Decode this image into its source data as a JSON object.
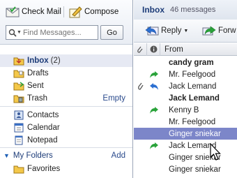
{
  "toolbar": {
    "check_mail": "Check Mail",
    "compose": "Compose",
    "search_placeholder": "Find Messages...",
    "go": "Go"
  },
  "folders": [
    {
      "label": "Inbox",
      "count": "(2)",
      "icon": "inbox-icon"
    },
    {
      "label": "Drafts",
      "icon": "drafts-folder-icon"
    },
    {
      "label": "Sent",
      "icon": "sent-folder-icon"
    },
    {
      "label": "Trash",
      "action": "Empty",
      "icon": "trash-icon"
    }
  ],
  "apps": [
    {
      "label": "Contacts",
      "icon": "contacts-icon"
    },
    {
      "label": "Calendar",
      "icon": "calendar-icon"
    },
    {
      "label": "Notepad",
      "icon": "notepad-icon"
    }
  ],
  "my_folders": {
    "label": "My Folders",
    "add": "Add",
    "items": [
      {
        "label": "Favorites",
        "icon": "folder-icon"
      }
    ]
  },
  "message_list": {
    "title": "Inbox",
    "count": "46 messages",
    "reply": "Reply",
    "forward": "Forw",
    "from_header": "From",
    "rows": [
      {
        "from": "candy gram",
        "unread": true,
        "status": "",
        "attachment": false
      },
      {
        "from": "Mr. Feelgood",
        "unread": false,
        "status": "forwarded",
        "attachment": false
      },
      {
        "from": "Jack Lemand",
        "unread": false,
        "status": "replied",
        "attachment": true
      },
      {
        "from": "Jack Lemand",
        "unread": true,
        "status": "",
        "attachment": false
      },
      {
        "from": "Kenny B",
        "unread": false,
        "status": "forwarded",
        "attachment": false
      },
      {
        "from": "Mr. Feelgood",
        "unread": false,
        "status": "",
        "attachment": false
      },
      {
        "from": "Ginger sniekar",
        "unread": false,
        "status": "",
        "attachment": false,
        "selected": true
      },
      {
        "from": "Jack Lemand",
        "unread": false,
        "status": "forwarded",
        "attachment": false
      },
      {
        "from": "Ginger sniekar",
        "unread": false,
        "status": "",
        "attachment": false
      },
      {
        "from": "Ginger sniekar",
        "unread": false,
        "status": "",
        "attachment": false
      }
    ]
  },
  "colors": {
    "selection": "#7c86c9",
    "accent": "#1d3c78",
    "forward_arrow": "#2aa33a",
    "reply_arrow": "#2b6fd1"
  }
}
